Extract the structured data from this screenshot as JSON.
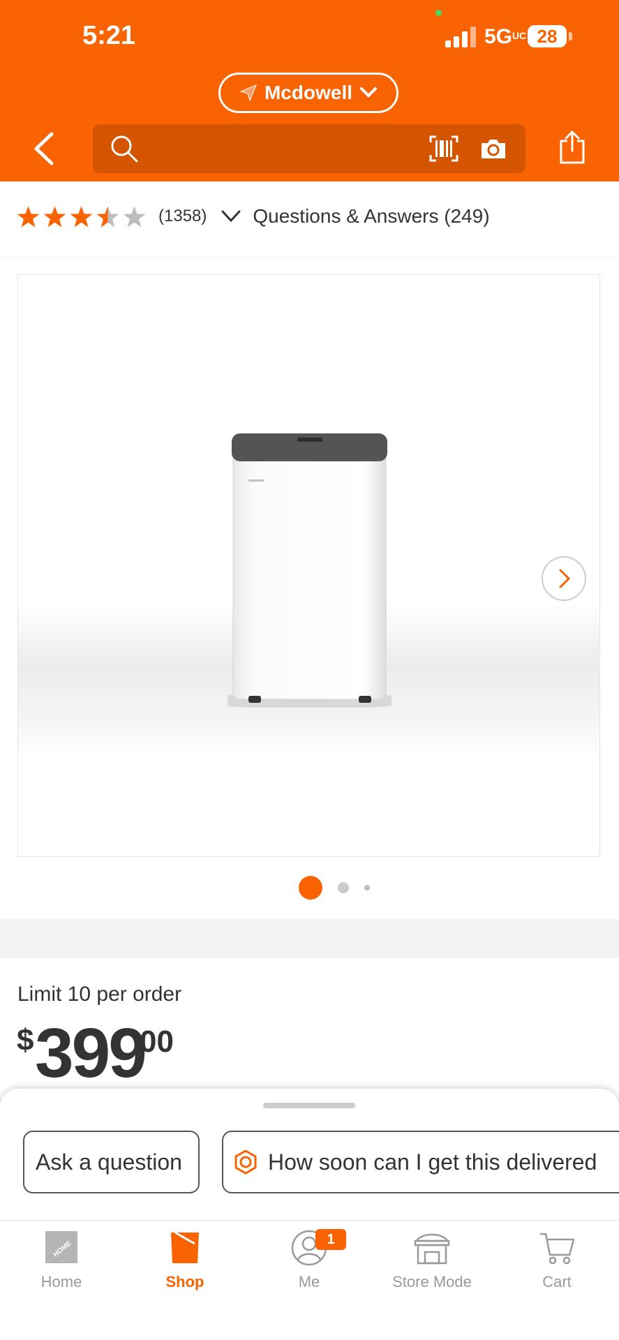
{
  "status_bar": {
    "time": "5:21",
    "network": "5G",
    "network_suffix": "UC",
    "battery": "28"
  },
  "header": {
    "store_name": "Mcdowell",
    "search_placeholder": ""
  },
  "rating": {
    "stars": 3.5,
    "review_count": "(1358)",
    "qa_label": "Questions & Answers (249)"
  },
  "gallery": {
    "total_images": 3,
    "current_index": 1
  },
  "product": {
    "limit_text": "Limit 10 per order",
    "price_dollar_sign": "$",
    "price_whole": "399",
    "price_cents": "00"
  },
  "actions": {
    "ask_question": "Ask a question",
    "delivery_question": "How soon can I get this delivered"
  },
  "bottom_nav": {
    "items": [
      {
        "label": "Home",
        "icon": "home-depot-logo-icon",
        "active": false
      },
      {
        "label": "Shop",
        "icon": "bucket-icon",
        "active": true
      },
      {
        "label": "Me",
        "icon": "person-icon",
        "active": false,
        "badge": "1"
      },
      {
        "label": "Store Mode",
        "icon": "store-icon",
        "active": false
      },
      {
        "label": "Cart",
        "icon": "cart-icon",
        "active": false
      }
    ]
  },
  "colors": {
    "brand_orange": "#f96302",
    "search_bg": "#d55400",
    "text": "#333333"
  }
}
